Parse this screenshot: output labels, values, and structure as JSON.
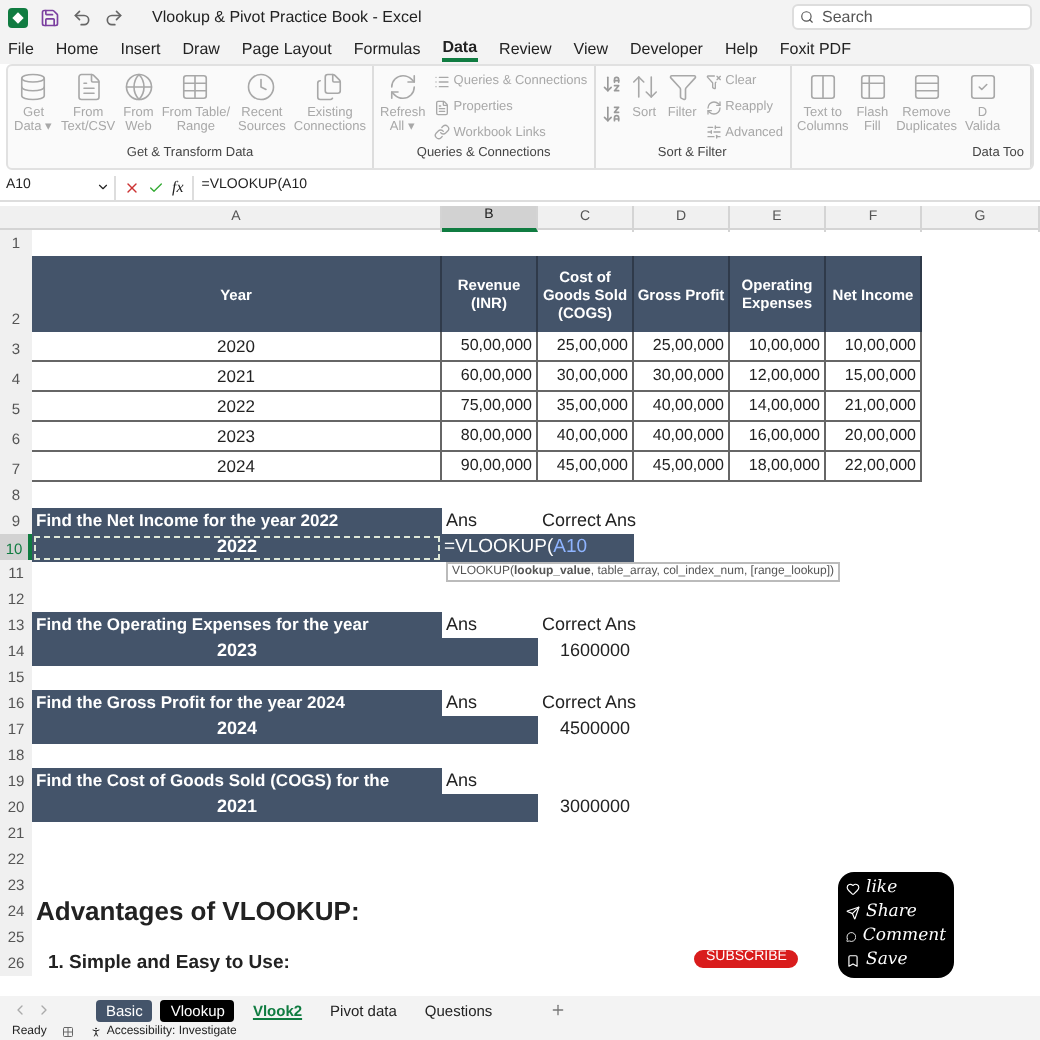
{
  "title_bar": {
    "title": "Vlookup & Pivot Practice Book  -  Excel",
    "search": {
      "placeholder": "Search"
    }
  },
  "menu_tabs": [
    {
      "label": "File",
      "selected": false
    },
    {
      "label": "Home",
      "selected": false
    },
    {
      "label": "Insert",
      "selected": false
    },
    {
      "label": "Draw",
      "selected": false
    },
    {
      "label": "Page Layout",
      "selected": false
    },
    {
      "label": "Formulas",
      "selected": false
    },
    {
      "label": "Data",
      "selected": true
    },
    {
      "label": "Review",
      "selected": false
    },
    {
      "label": "View",
      "selected": false
    },
    {
      "label": "Developer",
      "selected": false
    },
    {
      "label": "Help",
      "selected": false
    },
    {
      "label": "Foxit PDF",
      "selected": false
    }
  ],
  "ribbon": {
    "groups": [
      {
        "label": "Get & Transform Data",
        "columns": [
          {
            "kind": "large",
            "lines": [
              "Get",
              "Data ▾"
            ]
          },
          {
            "kind": "large",
            "lines": [
              "From",
              "Text/CSV"
            ]
          },
          {
            "kind": "large",
            "lines": [
              "From",
              "Web"
            ]
          },
          {
            "kind": "large",
            "lines": [
              "From Table/",
              "Range"
            ]
          },
          {
            "kind": "large",
            "lines": [
              "Recent",
              "Sources"
            ]
          },
          {
            "kind": "large",
            "lines": [
              "Existing",
              "Connections"
            ]
          }
        ]
      },
      {
        "label": "Queries & Connections",
        "columns": [
          {
            "kind": "large",
            "lines": [
              "Refresh",
              "All ▾"
            ]
          },
          {
            "kind": "stack",
            "items": [
              {
                "kind": "labeled",
                "label": "Queries & Connections"
              },
              {
                "kind": "labeled",
                "label": "Properties"
              },
              {
                "kind": "labeled",
                "label": "Workbook Links"
              }
            ]
          }
        ]
      },
      {
        "label": "Sort & Filter",
        "columns": [
          {
            "kind": "stack",
            "items": [
              {
                "kind": "icon"
              },
              {
                "kind": "icon"
              }
            ]
          },
          {
            "kind": "large",
            "lines": [
              "Sort"
            ]
          },
          {
            "kind": "large",
            "lines": [
              "Filter"
            ]
          },
          {
            "kind": "stack",
            "items": [
              {
                "kind": "labeled",
                "label": "Clear"
              },
              {
                "kind": "labeled",
                "label": "Reapply"
              },
              {
                "kind": "labeled",
                "label": "Advanced"
              }
            ]
          }
        ]
      },
      {
        "label": "Data Too",
        "columns": [
          {
            "kind": "large",
            "lines": [
              "Text to",
              "Columns"
            ]
          },
          {
            "kind": "large",
            "lines": [
              "Flash",
              "Fill"
            ]
          },
          {
            "kind": "large",
            "lines": [
              "Remove",
              "Duplicates"
            ]
          },
          {
            "kind": "large",
            "lines": [
              "D",
              "Valida"
            ]
          }
        ]
      }
    ]
  },
  "formula_bar": {
    "name_box": "A10",
    "function_label": "fx",
    "formula": "=VLOOKUP(A10"
  },
  "grid": {
    "columns": [
      {
        "label": "A",
        "selected": false
      },
      {
        "label": "B",
        "selected": true
      },
      {
        "label": "C",
        "selected": false
      },
      {
        "label": "D",
        "selected": false
      },
      {
        "label": "E",
        "selected": false
      },
      {
        "label": "F",
        "selected": false
      },
      {
        "label": "G",
        "selected": false
      }
    ],
    "rows": [
      {
        "number": "1",
        "kind": "plain",
        "selected": false,
        "cells": []
      },
      {
        "number": "2",
        "kind": "tall",
        "selected": false,
        "cells": [
          {
            "kind": "header",
            "text": "Year"
          },
          {
            "kind": "header",
            "text": "Revenue (INR)"
          },
          {
            "kind": "header",
            "text": "Cost of Goods Sold (COGS)"
          },
          {
            "kind": "header",
            "text": "Gross Profit"
          },
          {
            "kind": "header",
            "text": "Operating Expenses"
          },
          {
            "kind": "header",
            "text": "Net Income"
          }
        ]
      },
      {
        "number": "3",
        "kind": "data",
        "selected": false,
        "cells": [
          {
            "kind": "year",
            "text": "2020"
          },
          {
            "kind": "amount",
            "text": "50,00,000"
          },
          {
            "kind": "amount",
            "text": "25,00,000"
          },
          {
            "kind": "amount",
            "text": "25,00,000"
          },
          {
            "kind": "amount",
            "text": "10,00,000"
          },
          {
            "kind": "amount",
            "text": "10,00,000"
          }
        ]
      },
      {
        "number": "4",
        "kind": "data",
        "selected": false,
        "cells": [
          {
            "kind": "year",
            "text": "2021"
          },
          {
            "kind": "amount",
            "text": "60,00,000"
          },
          {
            "kind": "amount",
            "text": "30,00,000"
          },
          {
            "kind": "amount",
            "text": "30,00,000"
          },
          {
            "kind": "amount",
            "text": "12,00,000"
          },
          {
            "kind": "amount",
            "text": "15,00,000"
          }
        ]
      },
      {
        "number": "5",
        "kind": "data",
        "selected": false,
        "cells": [
          {
            "kind": "year",
            "text": "2022"
          },
          {
            "kind": "amount",
            "text": "75,00,000"
          },
          {
            "kind": "amount",
            "text": "35,00,000"
          },
          {
            "kind": "amount",
            "text": "40,00,000"
          },
          {
            "kind": "amount",
            "text": "14,00,000"
          },
          {
            "kind": "amount",
            "text": "21,00,000"
          }
        ]
      },
      {
        "number": "6",
        "kind": "data",
        "selected": false,
        "cells": [
          {
            "kind": "year",
            "text": "2023"
          },
          {
            "kind": "amount",
            "text": "80,00,000"
          },
          {
            "kind": "amount",
            "text": "40,00,000"
          },
          {
            "kind": "amount",
            "text": "40,00,000"
          },
          {
            "kind": "amount",
            "text": "16,00,000"
          },
          {
            "kind": "amount",
            "text": "20,00,000"
          }
        ]
      },
      {
        "number": "7",
        "kind": "data",
        "selected": false,
        "cells": [
          {
            "kind": "year",
            "text": "2024"
          },
          {
            "kind": "amount",
            "text": "90,00,000"
          },
          {
            "kind": "amount",
            "text": "45,00,000"
          },
          {
            "kind": "amount",
            "text": "45,00,000"
          },
          {
            "kind": "amount",
            "text": "18,00,000"
          },
          {
            "kind": "amount",
            "text": "22,00,000"
          }
        ]
      },
      {
        "number": "8",
        "kind": "plain",
        "selected": false,
        "cells": []
      },
      {
        "number": "9",
        "kind": "plain",
        "selected": false,
        "cells": [
          {
            "kind": "question",
            "text": "Find the Net Income for the year 2022"
          },
          {
            "kind": "label",
            "text": "Ans"
          },
          {
            "kind": "label",
            "text": "Correct Ans"
          }
        ]
      },
      {
        "number": "10",
        "kind": "plain",
        "selected": true,
        "cells": [
          {
            "kind": "question-value",
            "text": "2022",
            "selected": true
          },
          {
            "kind": "editing",
            "text": "=VLOOKUP(",
            "reference": "A10",
            "merge_right": true
          }
        ]
      },
      {
        "number": "11",
        "kind": "plain",
        "selected": false,
        "cells": [],
        "tooltip": "VLOOKUP(**lookup_value**, table_array, col_index_num, [range_lookup])"
      },
      {
        "number": "12",
        "kind": "plain",
        "selected": false,
        "cells": []
      },
      {
        "number": "13",
        "kind": "plain",
        "selected": false,
        "cells": [
          {
            "kind": "question",
            "text": "Find the Operating Expenses for the year"
          },
          {
            "kind": "label",
            "text": "Ans"
          },
          {
            "kind": "label",
            "text": "Correct Ans"
          }
        ]
      },
      {
        "number": "14",
        "kind": "plain",
        "selected": false,
        "cells": [
          {
            "kind": "question-value",
            "text": "2023",
            "selected": false
          },
          {
            "kind": "fill"
          },
          {
            "kind": "result",
            "text": "1600000"
          }
        ]
      },
      {
        "number": "15",
        "kind": "plain",
        "selected": false,
        "cells": []
      },
      {
        "number": "16",
        "kind": "plain",
        "selected": false,
        "cells": [
          {
            "kind": "question",
            "text": "Find the Gross Profit for the year 2024"
          },
          {
            "kind": "label",
            "text": "Ans"
          },
          {
            "kind": "label",
            "text": "Correct Ans"
          }
        ]
      },
      {
        "number": "17",
        "kind": "plain",
        "selected": false,
        "cells": [
          {
            "kind": "question-value",
            "text": "2024",
            "selected": false
          },
          {
            "kind": "fill"
          },
          {
            "kind": "result",
            "text": "4500000"
          }
        ]
      },
      {
        "number": "18",
        "kind": "plain",
        "selected": false,
        "cells": []
      },
      {
        "number": "19",
        "kind": "plain",
        "selected": false,
        "cells": [
          {
            "kind": "question",
            "text": "Find the Cost of Goods Sold (COGS) for the"
          },
          {
            "kind": "label",
            "text": "Ans"
          }
        ]
      },
      {
        "number": "20",
        "kind": "plain",
        "selected": false,
        "cells": [
          {
            "kind": "question-value",
            "text": "2021",
            "selected": false
          },
          {
            "kind": "fill"
          },
          {
            "kind": "result",
            "text": "3000000"
          }
        ]
      },
      {
        "number": "21",
        "kind": "plain",
        "selected": false,
        "cells": []
      },
      {
        "number": "22",
        "kind": "plain",
        "selected": false,
        "cells": []
      },
      {
        "number": "23",
        "kind": "plain",
        "selected": false,
        "cells": []
      },
      {
        "number": "24",
        "kind": "plain",
        "selected": false,
        "cells": [
          {
            "kind": "heading",
            "text": "Advantages of VLOOKUP:"
          }
        ]
      },
      {
        "number": "25",
        "kind": "plain",
        "selected": false,
        "cells": []
      },
      {
        "number": "26",
        "kind": "plain",
        "selected": false,
        "cells": [
          {
            "kind": "subheading",
            "text": "1. Simple and Easy to Use:"
          }
        ]
      }
    ]
  },
  "overlay": {
    "subscribe": "SUBSCRIBE",
    "actions": [
      {
        "kind": "like",
        "label": "like"
      },
      {
        "kind": "share",
        "label": "Share"
      },
      {
        "kind": "comment",
        "label": "Comment"
      },
      {
        "kind": "save",
        "label": "Save"
      }
    ]
  },
  "sheet_tabs": [
    {
      "label": "Basic",
      "selected": false,
      "color": "#44546a"
    },
    {
      "label": "Vlookup",
      "selected": false,
      "color": "#000000"
    },
    {
      "label": "Vlook2",
      "selected": true
    },
    {
      "label": "Pivot data",
      "selected": false
    },
    {
      "label": "Questions",
      "selected": false
    }
  ],
  "status_bar": {
    "mode": "Ready",
    "accessibility": "Accessibility: Investigate"
  }
}
